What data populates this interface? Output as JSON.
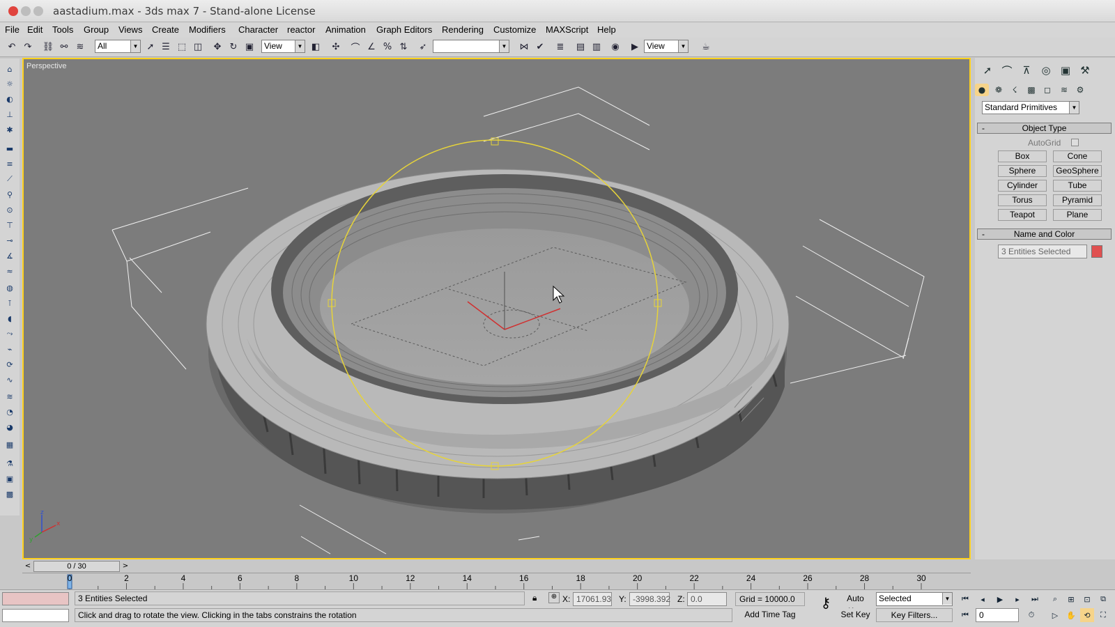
{
  "window": {
    "title": "aastadium.max - 3ds max 7 - Stand-alone License"
  },
  "menu": [
    "File",
    "Edit",
    "Tools",
    "Group",
    "Views",
    "Create",
    "Modifiers",
    "Character",
    "reactor",
    "Animation",
    "Graph Editors",
    "Rendering",
    "Customize",
    "MAXScript",
    "Help"
  ],
  "toolbar": {
    "selection_filter": "All",
    "ref_coord_1": "View",
    "named_selection": "",
    "ref_coord_2": "View"
  },
  "viewport": {
    "label": "Perspective",
    "axis_labels": [
      "x",
      "y",
      "z"
    ]
  },
  "command_panel": {
    "category": "Standard Primitives",
    "object_type_title": "Object Type",
    "autogrid_label": "AutoGrid",
    "buttons": [
      "Box",
      "Cone",
      "Sphere",
      "GeoSphere",
      "Cylinder",
      "Tube",
      "Torus",
      "Pyramid",
      "Teapot",
      "Plane"
    ],
    "name_color_title": "Name and Color",
    "name_value": "3 Entities Selected",
    "object_color": "#e05050",
    "rollout_collapse": "-"
  },
  "timeline": {
    "frame_display": "0 / 30",
    "ticks": [
      "0",
      "2",
      "4",
      "6",
      "8",
      "10",
      "12",
      "14",
      "16",
      "18",
      "20",
      "22",
      "24",
      "26",
      "28",
      "30"
    ]
  },
  "status": {
    "selection": "3 Entities Selected",
    "prompt": "Click and drag to rotate the view.  Clicking in the tabs constrains the rotation",
    "x_label": "X:",
    "x_value": "17061.93",
    "y_label": "Y:",
    "y_value": "-3998.392",
    "z_label": "Z:",
    "z_value": "0.0",
    "grid": "Grid = 10000.0",
    "add_time_tag": "Add Time Tag",
    "auto_key": "Auto Key",
    "set_key": "Set Key",
    "key_mode": "Selected",
    "key_filters": "Key Filters...",
    "current_frame": "0"
  }
}
